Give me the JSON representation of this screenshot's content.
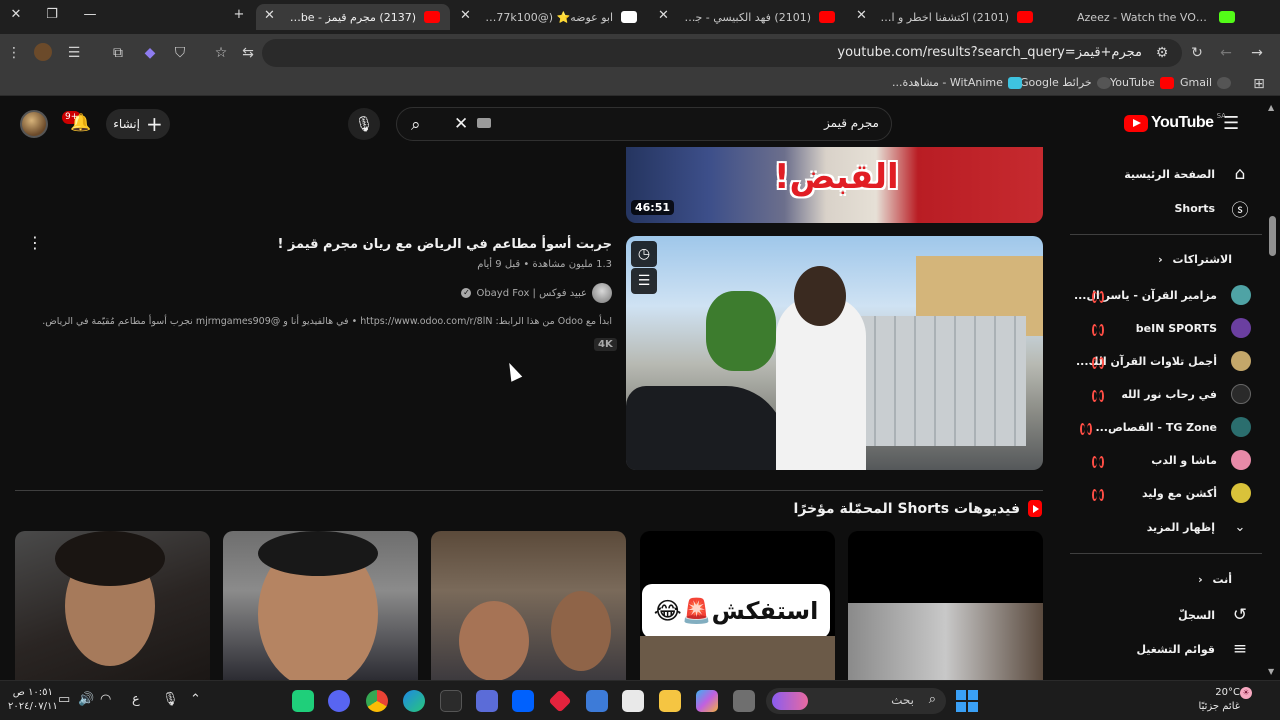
{
  "browser": {
    "tabs": [
      {
        "title": "Azeez - Watch the VOD on Kick",
        "icon": "kick-favicon",
        "color": "#53fc18"
      },
      {
        "title": "(2101) اكتشفنا اخطر و اغرب اماك",
        "icon": "youtube-favicon",
        "color": "#ff0000"
      },
      {
        "title": "(2101) فهد الكبيسي - جعل السحاب",
        "icon": "youtube-favicon",
        "color": "#ff0000"
      },
      {
        "title": "ابو عوضه⭐️ (@77k100) | TikTok",
        "icon": "tiktok-favicon",
        "color": "#ffffff"
      },
      {
        "title": "(2137) مجرم قيمز - YouTube",
        "icon": "youtube-favicon",
        "color": "#ff0000",
        "active": true
      }
    ],
    "url": "youtube.com/results?search_query=مجرم+قيمز",
    "bookmarks": [
      {
        "label": "Gmail",
        "icon": "gmail-icon"
      },
      {
        "label": "YouTube",
        "icon": "youtube-icon"
      },
      {
        "label": "خرائط Google",
        "icon": "maps-icon"
      },
      {
        "label": "WitAnime - مشاهدة...",
        "icon": "witanime-icon"
      }
    ]
  },
  "header": {
    "logo_text": "YouTube",
    "country_code": "SA",
    "search_value": "مجرم قيمز",
    "create_label": "إنشاء",
    "notification_count": "9+"
  },
  "sidebar": {
    "top": [
      {
        "label": "الصفحة الرئيسية",
        "icon": "home-icon"
      },
      {
        "label": "Shorts",
        "icon": "shorts-icon"
      }
    ],
    "subscriptions_heading": "الاشتراكات",
    "subscriptions": [
      {
        "label": "مزامير القرآن - ياسر ال...",
        "color": "#4fa3a5"
      },
      {
        "label": "beIN SPORTS",
        "color": "#6b3fa0"
      },
      {
        "label": "أجمل تلاوات القرآن الك...",
        "color": "#c4a76a"
      },
      {
        "label": "في رحاب نور الله",
        "color": "#2a2a2a"
      },
      {
        "label": "TG Zone - القصاص...",
        "color": "#2b6e6e"
      },
      {
        "label": "ماشا و الدب",
        "color": "#e88aa8"
      },
      {
        "label": "أكشن مع وليد",
        "color": "#d9c23a"
      }
    ],
    "show_more": "إظهار المزيد",
    "you_heading": "أنت",
    "you_items": [
      {
        "label": "السجلّ",
        "icon": "history-icon"
      },
      {
        "label": "قوائم التشغيل",
        "icon": "playlists-icon"
      }
    ]
  },
  "results": {
    "prev_duration": "46:51",
    "prev_thumb_text": "القبض!",
    "video": {
      "title": "جربت أسوأ مطاعم في الرياض مع ريان مجرم قيمز !",
      "meta": "1.3 مليون مشاهدة • قبل 9 أيام",
      "channel": "عبيد فوكس | Obayd Fox",
      "description": "ابدأ مع Odoo من هذا الرابط: https://www.odoo.com/r/8lN • في هالفيديو أنا و @mjrmgames909 نجرب أسوأ مطاعم مُقيّمة في الرياض.",
      "badge": "4K"
    },
    "shorts_heading": "فيديوهات Shorts المحمّلة مؤخرًا",
    "shorts_caption": "استفكش🚨😂"
  },
  "taskbar": {
    "search_label": "بحث",
    "time": "١٠:٥١ ص",
    "date": "٢٠٢٤/٠٧/١١",
    "lang": "ع",
    "temperature": "20°C",
    "weather_label": "غائم جزئيًا"
  }
}
